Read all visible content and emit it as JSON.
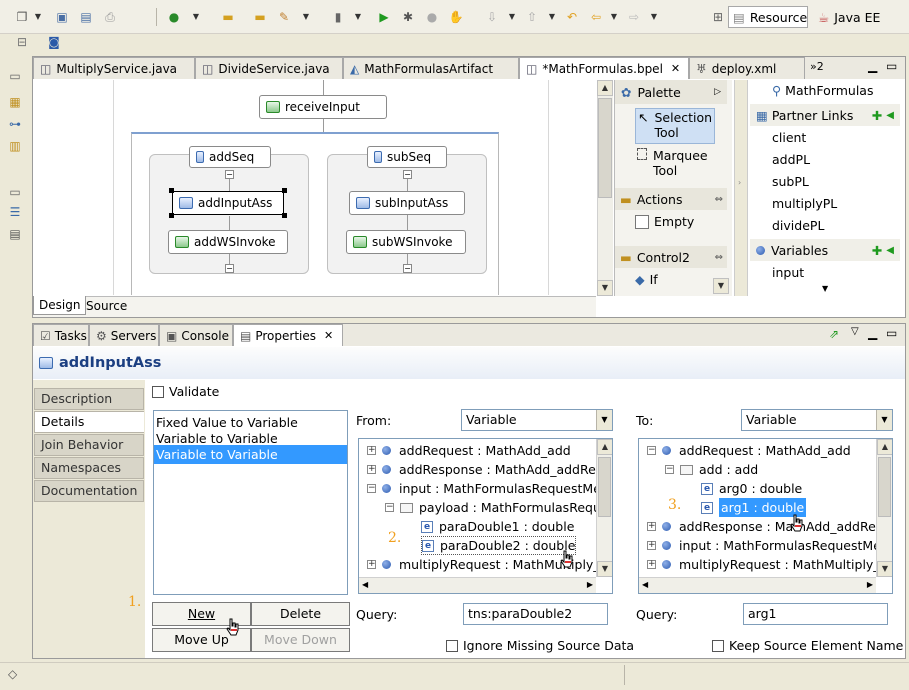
{
  "perspectives": {
    "resource": "Resource",
    "javaee": "Java EE"
  },
  "editor_tabs": [
    "MultiplyService.java",
    "DivideService.java",
    "MathFormulasArtifact",
    "*MathFormulas.bpel",
    "deploy.xml"
  ],
  "editor_overflow": "»2",
  "diagram": {
    "receive": "receiveInput",
    "addSeq": "addSeq",
    "subSeq": "subSeq",
    "addAssign": "addInputAss",
    "subAssign": "subInputAss",
    "addInvoke": "addWSInvoke",
    "subInvoke": "subWSInvoke"
  },
  "bottom_tabs": {
    "design": "Design",
    "source": "Source"
  },
  "palette": {
    "title": "Palette",
    "selection": "Selection Tool",
    "marquee": "Marquee Tool",
    "actions": "Actions",
    "empty": "Empty",
    "control": "Control2",
    "if": "If"
  },
  "outline": {
    "title": "MathFormulas",
    "partner_links": "Partner Links",
    "links": [
      "client",
      "addPL",
      "subPL",
      "multiplyPL",
      "dividePL"
    ],
    "variables": "Variables",
    "vars": [
      "input"
    ]
  },
  "view_tabs": [
    "Tasks",
    "Servers",
    "Console",
    "Properties"
  ],
  "properties": {
    "title": "addInputAss",
    "side_tabs": [
      "Description",
      "Details",
      "Join Behavior",
      "Namespaces",
      "Documentation"
    ],
    "validate": "Validate",
    "copy_rules": [
      "Fixed Value to Variable",
      "Variable to Variable",
      "Variable to Variable"
    ],
    "from_label": "From:",
    "to_label": "To:",
    "from_type": "Variable",
    "to_type": "Variable",
    "from_tree": [
      "addRequest : MathAdd_add",
      "addResponse : MathAdd_addResp",
      "input : MathFormulasRequestMess",
      "payload : MathFormulasReque",
      "paraDouble1 : double",
      "paraDouble2 : double",
      "multiplyRequest : MathMultiply_m"
    ],
    "to_tree": [
      "addRequest : MathAdd_add",
      "add : add",
      "arg0 : double",
      "arg1 : double",
      "addResponse : MathAdd_addResp",
      "input : MathFormulasRequestMess",
      "multiplyRequest : MathMultiply_m"
    ],
    "query_label": "Query:",
    "from_query": "tns:paraDouble2",
    "to_query": "arg1",
    "buttons": {
      "new": "New",
      "delete": "Delete",
      "move_up": "Move Up",
      "move_down": "Move Down"
    },
    "ignore_missing": "Ignore Missing Source Data",
    "keep_source": "Keep Source Element Name",
    "steps": [
      "1.",
      "2.",
      "3."
    ]
  }
}
